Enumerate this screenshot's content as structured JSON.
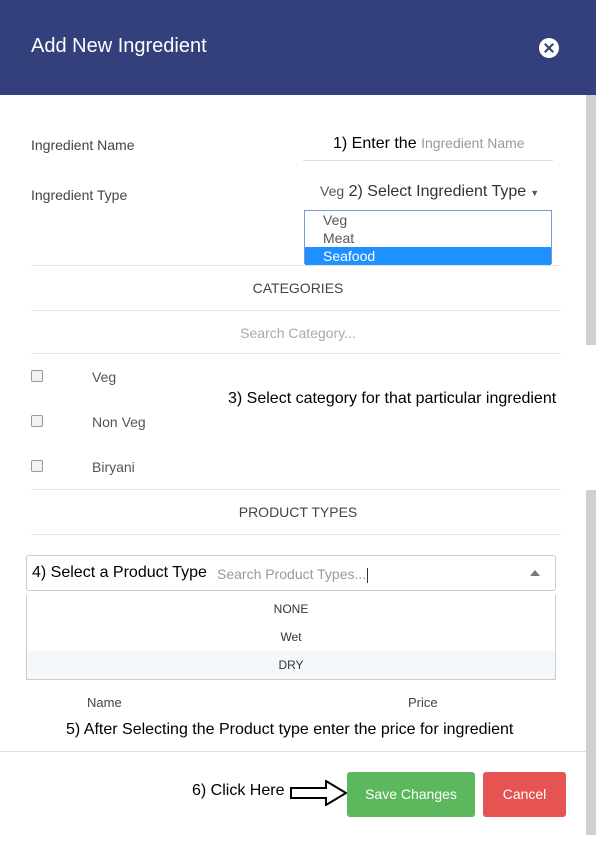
{
  "header": {
    "title": "Add New Ingredient"
  },
  "ingredient_name": {
    "label": "Ingredient Name",
    "annotation": "1) Enter the",
    "placeholder": "Ingredient Name"
  },
  "ingredient_type": {
    "label": "Ingredient Type",
    "selected": "Veg",
    "annotation": "2) Select Ingredient Type",
    "options": [
      "Veg",
      "Meat",
      "Seafood"
    ],
    "highlighted": "Seafood"
  },
  "categories": {
    "title": "CATEGORIES",
    "search_placeholder": "Search Category...",
    "annotation": "3) Select category for that particular ingredient",
    "items": [
      "Veg",
      "Non Veg",
      "Biryani"
    ]
  },
  "product_types": {
    "title": "PRODUCT TYPES",
    "annotation": "4) Select a Product Type",
    "search_placeholder": "Search Product Types...",
    "options": [
      "NONE",
      "Wet",
      "DRY"
    ]
  },
  "price_table": {
    "col_name": "Name",
    "col_price": "Price",
    "annotation": "5) After Selecting the Product type enter the price for ingredient"
  },
  "footer": {
    "annotation": "6) Click Here",
    "save_label": "Save Changes",
    "cancel_label": "Cancel"
  },
  "colors": {
    "header": "#33407b",
    "save": "#5cb85c",
    "cancel": "#e55353",
    "highlight": "#1e90ff"
  }
}
